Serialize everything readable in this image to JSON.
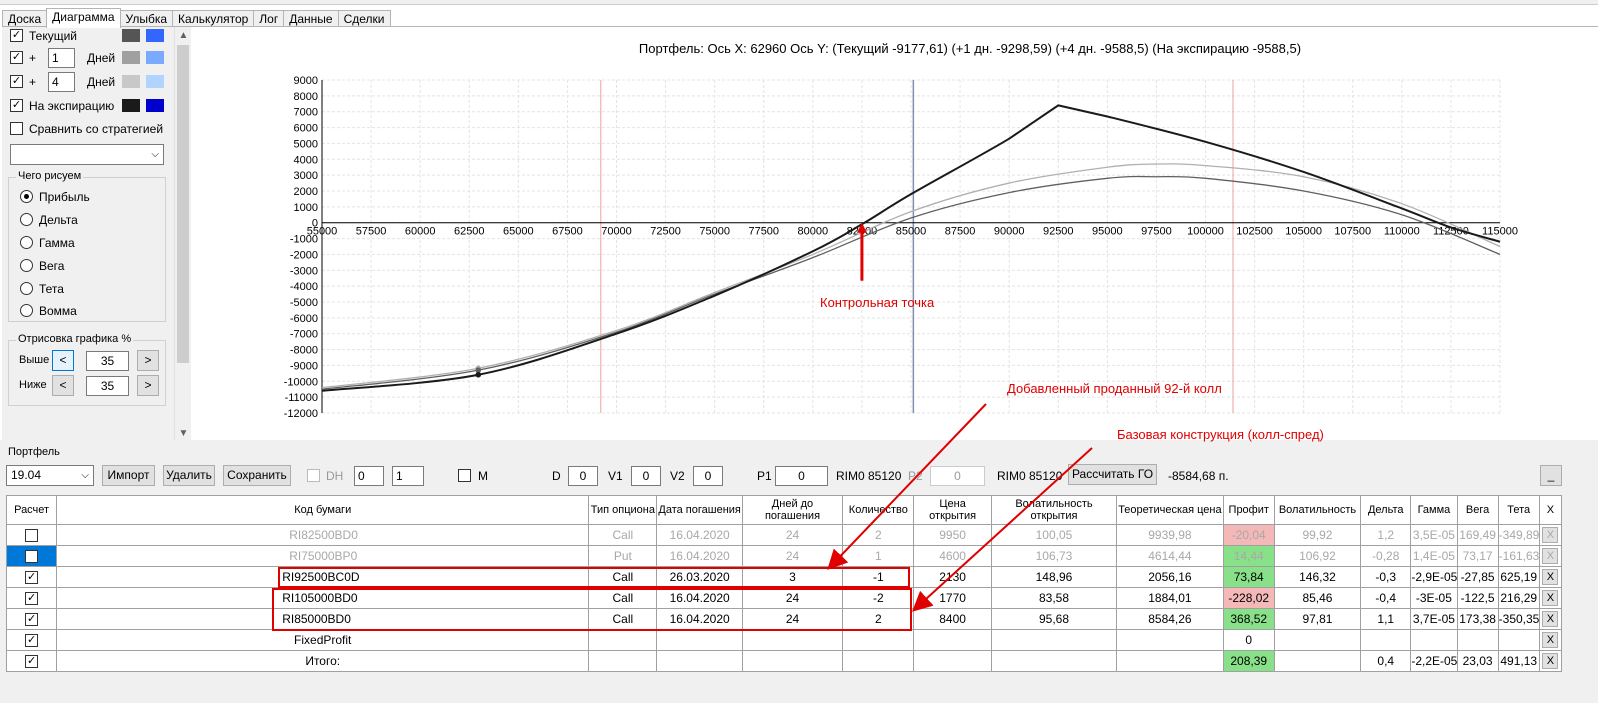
{
  "tabs": [
    "Доска",
    "Диаграмма",
    "Улыбка",
    "Калькулятор",
    "Лог",
    "Данные",
    "Сделки"
  ],
  "left_panel": {
    "current_label": "Текущий",
    "plus1": "+",
    "days1": "1",
    "days1_unit": "Дней",
    "plus2": "+",
    "days2": "4",
    "days2_unit": "Дней",
    "expiry_label": "На экспирацию",
    "compare_label": "Сравнить со стратегией",
    "draw_group": "Чего рисуем",
    "radio": [
      "Прибыль",
      "Дельта",
      "Гамма",
      "Вега",
      "Тета",
      "Вомма"
    ],
    "range_group": "Отрисовка графика %",
    "above_label": "Выше",
    "above_value": "35",
    "below_label": "Ниже",
    "below_value": "35",
    "btn_less": "<",
    "btn_more": ">"
  },
  "chart_title": "Портфель: Ось X: 62960 Ось Y:  (Текущий -9177,61)  (+1 дн. -9298,59)  (+4 дн. -9588,5)  (На экспирацию -9588,5)",
  "chart_data": {
    "type": "line",
    "title": "Портфель: Ось X: 62960 Ось Y:  (Текущий -9177,61)  (+1 дн. -9298,59)  (+4 дн. -9588,5)  (На экспирацию -9588,5)",
    "x_ticks": [
      55000,
      57500,
      60000,
      62500,
      65000,
      67500,
      70000,
      72500,
      75000,
      77500,
      80000,
      82500,
      85000,
      87500,
      90000,
      92500,
      95000,
      97500,
      100000,
      102500,
      105000,
      107500,
      110000,
      112500,
      115000
    ],
    "y_ticks": [
      9000,
      8000,
      7000,
      6000,
      5000,
      4000,
      3000,
      2000,
      1000,
      0,
      -1000,
      -2000,
      -3000,
      -4000,
      -5000,
      -6000,
      -7000,
      -8000,
      -9000,
      -10000,
      -11000,
      -12000
    ],
    "xlim": [
      55000,
      115000
    ],
    "ylim": [
      -12000,
      9000
    ],
    "grid": true,
    "vertical_markers": [
      {
        "x": 69200,
        "color": "#f0a0a0"
      },
      {
        "x": 85120,
        "color": "#8090b0"
      },
      {
        "x": 101400,
        "color": "#f0a0a0"
      }
    ],
    "control_point": {
      "x": 82500,
      "y": 0
    },
    "series": [
      {
        "color": "#1a1a1a",
        "width": 2,
        "x": [
          55000,
          62960,
          70000,
          75000,
          80000,
          82500,
          85000,
          90000,
          92500,
          95000,
          100000,
          105000,
          110000,
          112500,
          115000
        ],
        "y": [
          -10600,
          -9588.5,
          -7000,
          -4600,
          -1800,
          -100,
          1800,
          5300,
          7400,
          6700,
          5100,
          3200,
          900,
          -300,
          -1200
        ]
      },
      {
        "color": "#606060",
        "width": 1.3,
        "x": [
          55000,
          62960,
          70000,
          75000,
          80000,
          85000,
          90000,
          95000,
          97500,
          100000,
          105000,
          110000,
          115000
        ],
        "y": [
          -10500,
          -9298.59,
          -6900,
          -4500,
          -2200,
          300,
          1900,
          2800,
          2900,
          2800,
          2000,
          500,
          -2000
        ]
      },
      {
        "color": "#b0b0b0",
        "width": 1.3,
        "x": [
          55000,
          62960,
          70000,
          75000,
          80000,
          85000,
          90000,
          95000,
          97500,
          100000,
          105000,
          110000,
          115000
        ],
        "y": [
          -10400,
          -9177.61,
          -6800,
          -4400,
          -2000,
          700,
          2500,
          3500,
          3700,
          3600,
          2900,
          1200,
          -1500
        ]
      }
    ]
  },
  "colors": {
    "cur_dark": "#555555",
    "cur_light": "#3366ff",
    "d1_dark": "#a0a0a0",
    "d1_light": "#7aaaff",
    "d4_dark": "#c8c8c8",
    "d4_light": "#b0d4ff",
    "exp_dark": "#1a1a1a",
    "exp_light": "#0000cc"
  },
  "portfolio": {
    "label": "Портфель",
    "selected": "19.04",
    "import": "Импорт",
    "delete": "Удалить",
    "save": "Сохранить",
    "dh": "DH",
    "dh1": "0",
    "dh2": "1",
    "m": "M",
    "d_label": "D",
    "d_value": "0",
    "v1_label": "V1",
    "v1_value": "0",
    "v2_label": "V2",
    "v2_value": "0",
    "p1_label": "P1",
    "p1_value": "0",
    "p1_instrument": "RIM0 85120",
    "p2_label": "P2",
    "p2_value": "0",
    "p2_instrument": "RIM0 85120",
    "calc_go": "Рассчитать ГО",
    "go_value": "-8584,68 п.",
    "min_btn": "_"
  },
  "table": {
    "headers": [
      "Расчет",
      "Код бумаги",
      "Тип опциона",
      "Дата погашения",
      "Дней до погашения",
      "Количество",
      "Цена открытия",
      "Волатильность открытия",
      "Теоретическая цена",
      "Профит",
      "Волатильность",
      "Дельта",
      "Гамма",
      "Вега",
      "Тета",
      "X"
    ],
    "rows": [
      {
        "checked": false,
        "dim": true,
        "code": "RI82500BD0",
        "type": "Call",
        "date": "16.04.2020",
        "days": "24",
        "qty": "2",
        "price": "9950",
        "vol_open": "100,05",
        "theo": "9939,98",
        "profit": "-20,04",
        "profit_bg": "pink",
        "vol": "99,92",
        "delta": "1,2",
        "gamma": "3,5E-05",
        "vega": "169,49",
        "theta": "-349,89",
        "x": "X"
      },
      {
        "checked": false,
        "dim": true,
        "sel": true,
        "code": "RI75000BP0",
        "type": "Put",
        "date": "16.04.2020",
        "days": "24",
        "qty": "1",
        "price": "4600",
        "vol_open": "106,73",
        "theo": "4614,44",
        "profit": "14,44",
        "profit_bg": "green",
        "vol": "106,92",
        "delta": "-0,28",
        "gamma": "1,4E-05",
        "vega": "73,17",
        "theta": "-161,63",
        "x": "X"
      },
      {
        "checked": true,
        "dim": false,
        "code": "RI92500BC0D",
        "type": "Call",
        "date": "26.03.2020",
        "days": "3",
        "qty": "-1",
        "price": "2130",
        "vol_open": "148,96",
        "theo": "2056,16",
        "profit": "73,84",
        "profit_bg": "green",
        "vol": "146,32",
        "delta": "-0,3",
        "gamma": "-2,9E-05",
        "vega": "-27,85",
        "theta": "625,19",
        "x": "X"
      },
      {
        "checked": true,
        "dim": false,
        "code": "RI105000BD0",
        "type": "Call",
        "date": "16.04.2020",
        "days": "24",
        "qty": "-2",
        "price": "1770",
        "vol_open": "83,58",
        "theo": "1884,01",
        "profit": "-228,02",
        "profit_bg": "pink",
        "vol": "85,46",
        "delta": "-0,4",
        "gamma": "-3E-05",
        "vega": "-122,5",
        "theta": "216,29",
        "x": "X"
      },
      {
        "checked": true,
        "dim": false,
        "code": "RI85000BD0",
        "type": "Call",
        "date": "16.04.2020",
        "days": "24",
        "qty": "2",
        "price": "8400",
        "vol_open": "95,68",
        "theo": "8584,26",
        "profit": "368,52",
        "profit_bg": "green",
        "vol": "97,81",
        "delta": "1,1",
        "gamma": "3,7E-05",
        "vega": "173,38",
        "theta": "-350,35",
        "x": "X"
      },
      {
        "checked": true,
        "dim": false,
        "code": "FixedProfit",
        "type": "",
        "date": "",
        "days": "",
        "qty": "",
        "price": "",
        "vol_open": "",
        "theo": "",
        "profit": "0",
        "profit_bg": "",
        "vol": "",
        "delta": "",
        "gamma": "",
        "vega": "",
        "theta": "",
        "x": "X"
      },
      {
        "checked": true,
        "dim": false,
        "code": "Итого:",
        "type": "",
        "date": "",
        "days": "",
        "qty": "",
        "price": "",
        "vol_open": "",
        "theo": "",
        "profit": "208,39",
        "profit_bg": "green",
        "vol": "",
        "delta": "0,4",
        "gamma": "-2,2E-05",
        "vega": "23,03",
        "theta": "491,13",
        "x": "X"
      }
    ]
  },
  "annotations": {
    "control_point": "Контрольная точка",
    "added_call": "Добавленный проданный 92-й колл",
    "base_structure": "Базовая конструкция (колл-спред)"
  }
}
